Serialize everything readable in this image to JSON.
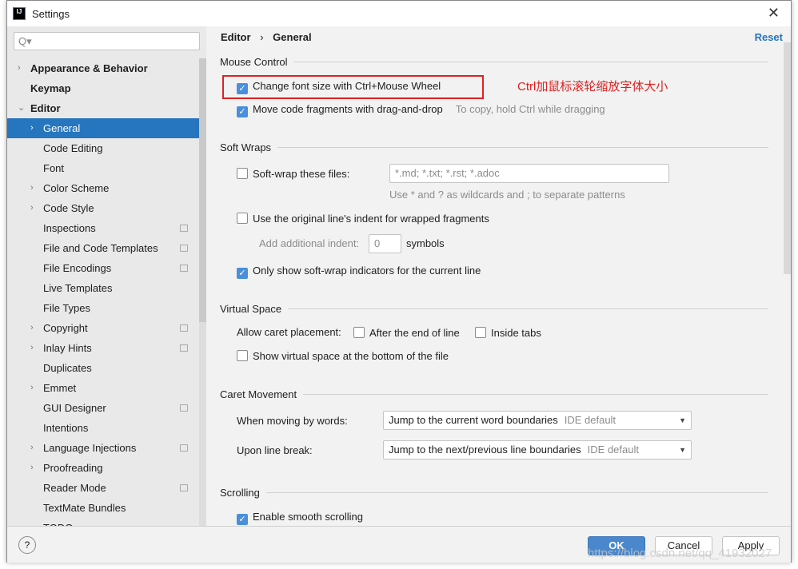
{
  "window": {
    "title": "Settings",
    "logo": "IJ"
  },
  "search": {
    "placeholder": "Q▾"
  },
  "tree": [
    {
      "label": "Appearance & Behavior",
      "bold": true,
      "arrow": "›",
      "level": 0
    },
    {
      "label": "Keymap",
      "bold": true,
      "arrow": "",
      "level": 0
    },
    {
      "label": "Editor",
      "bold": true,
      "arrow": "⌄",
      "level": 0
    },
    {
      "label": "General",
      "arrow": "›",
      "level": 1,
      "selected": true
    },
    {
      "label": "Code Editing",
      "arrow": "",
      "level": 1
    },
    {
      "label": "Font",
      "arrow": "",
      "level": 1
    },
    {
      "label": "Color Scheme",
      "arrow": "›",
      "level": 1
    },
    {
      "label": "Code Style",
      "arrow": "›",
      "level": 1
    },
    {
      "label": "Inspections",
      "arrow": "",
      "level": 1,
      "copy": true
    },
    {
      "label": "File and Code Templates",
      "arrow": "",
      "level": 1,
      "copy": true
    },
    {
      "label": "File Encodings",
      "arrow": "",
      "level": 1,
      "copy": true
    },
    {
      "label": "Live Templates",
      "arrow": "",
      "level": 1
    },
    {
      "label": "File Types",
      "arrow": "",
      "level": 1
    },
    {
      "label": "Copyright",
      "arrow": "›",
      "level": 1,
      "copy": true
    },
    {
      "label": "Inlay Hints",
      "arrow": "›",
      "level": 1,
      "copy": true
    },
    {
      "label": "Duplicates",
      "arrow": "",
      "level": 1
    },
    {
      "label": "Emmet",
      "arrow": "›",
      "level": 1
    },
    {
      "label": "GUI Designer",
      "arrow": "",
      "level": 1,
      "copy": true
    },
    {
      "label": "Intentions",
      "arrow": "",
      "level": 1
    },
    {
      "label": "Language Injections",
      "arrow": "›",
      "level": 1,
      "copy": true
    },
    {
      "label": "Proofreading",
      "arrow": "›",
      "level": 1
    },
    {
      "label": "Reader Mode",
      "arrow": "",
      "level": 1,
      "copy": true
    },
    {
      "label": "TextMate Bundles",
      "arrow": "",
      "level": 1
    },
    {
      "label": "TODO",
      "arrow": "",
      "level": 1
    }
  ],
  "breadcrumb": {
    "first": "Editor",
    "sep": "›",
    "second": "General"
  },
  "reset": "Reset",
  "mouse": {
    "title": "Mouse Control",
    "change_font": "Change font size with Ctrl+Mouse Wheel",
    "annotation": "Ctrl加鼠标滚轮缩放字体大小",
    "drag": "Move code fragments with drag-and-drop",
    "drag_hint": "To copy, hold Ctrl while dragging"
  },
  "soft": {
    "title": "Soft Wraps",
    "files": "Soft-wrap these files:",
    "files_placeholder": "*.md; *.txt; *.rst; *.adoc",
    "hint": "Use * and ? as wildcards and ; to separate patterns",
    "indent": "Use the original line's indent for wrapped fragments",
    "add_indent": "Add additional indent:",
    "add_indent_value": "0",
    "symbols": "symbols",
    "indicators": "Only show soft-wrap indicators for the current line"
  },
  "virtual": {
    "title": "Virtual Space",
    "allow": "Allow caret placement:",
    "after_end": "After the end of line",
    "inside_tabs": "Inside tabs",
    "bottom": "Show virtual space at the bottom of the file"
  },
  "caret": {
    "title": "Caret Movement",
    "words": "When moving by words:",
    "words_value": "Jump to the current word boundaries",
    "words_default": "IDE default",
    "line": "Upon line break:",
    "line_value": "Jump to the next/previous line boundaries",
    "line_default": "IDE default"
  },
  "scrolling": {
    "title": "Scrolling",
    "smooth": "Enable smooth scrolling"
  },
  "footer": {
    "help": "?",
    "ok": "OK",
    "cancel": "Cancel",
    "apply": "Apply"
  },
  "watermark": "https://blog.csdn.net/qq_41932027",
  "colors": {
    "accent": "#2675bf",
    "annotation": "#e02020"
  }
}
